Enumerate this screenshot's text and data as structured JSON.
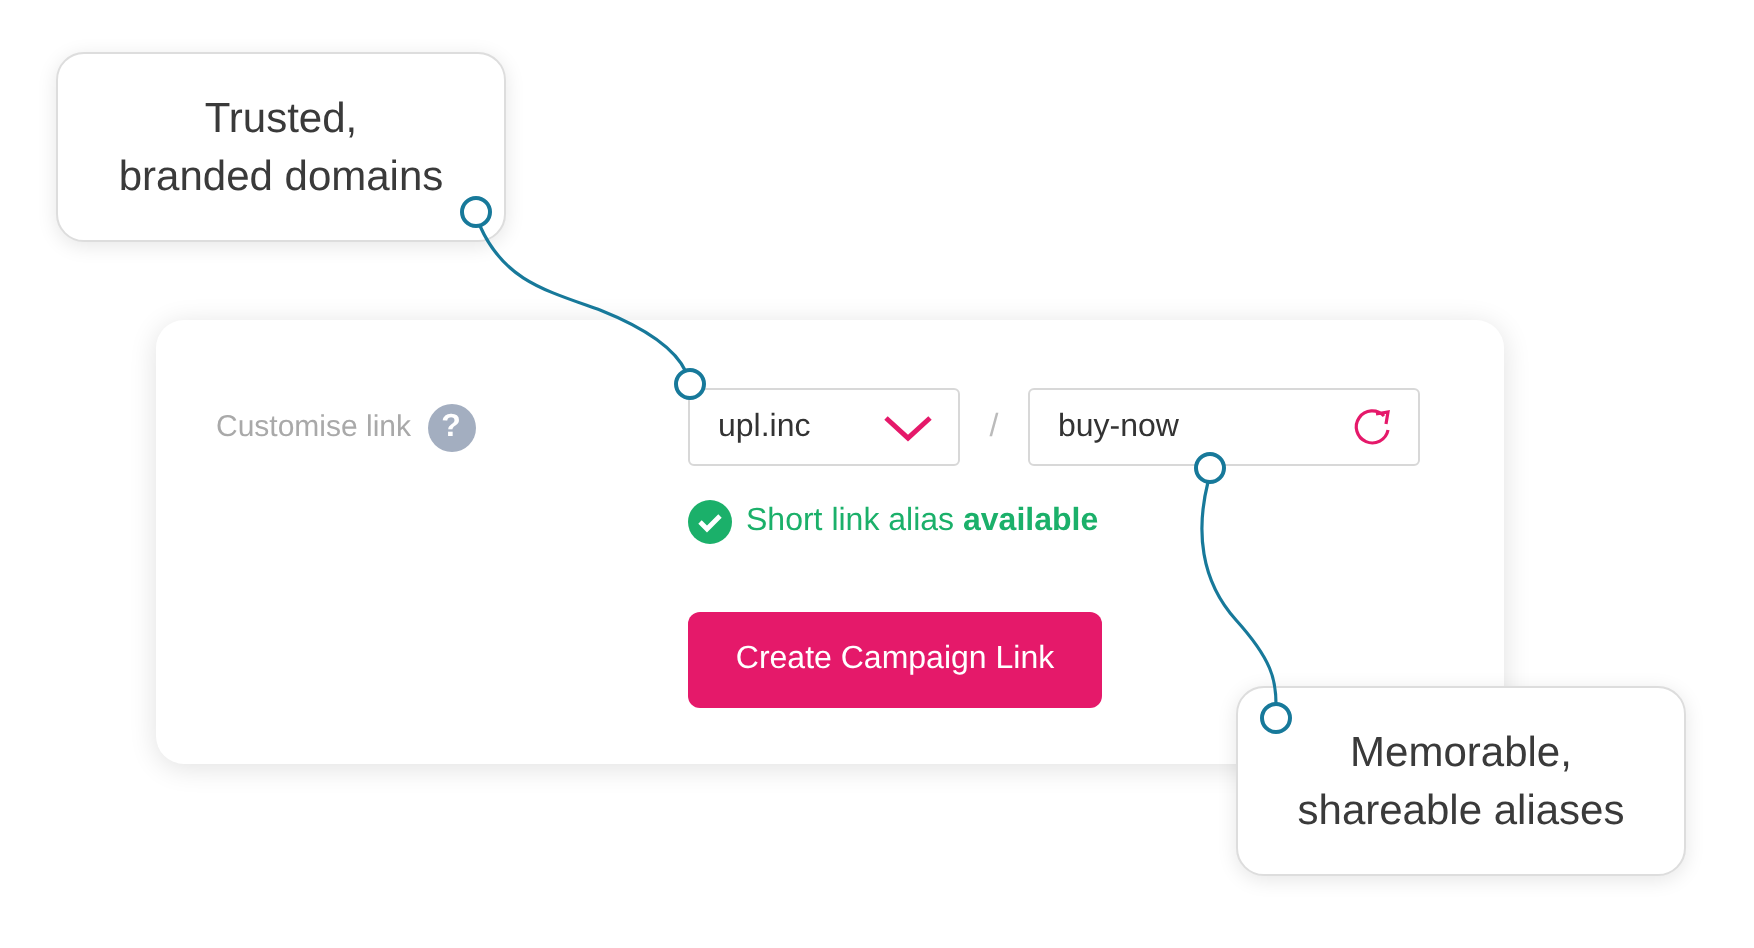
{
  "form": {
    "label": "Customise link",
    "help": "?",
    "domain_select": {
      "value": "upl.inc"
    },
    "separator": "/",
    "alias_field": {
      "value": "buy-now"
    },
    "status": {
      "kind": "success",
      "text": "Short link alias **available**"
    },
    "button": "Create Campaign Link"
  },
  "callouts": [
    {
      "text": "Trusted,\nbranded domains"
    },
    {
      "text": "Memorable,\nshareable aliases"
    }
  ]
}
